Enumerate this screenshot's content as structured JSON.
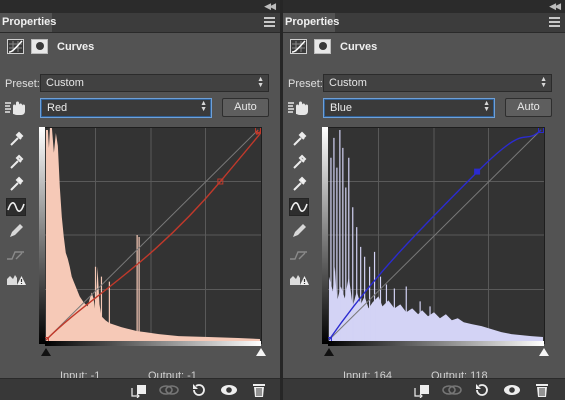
{
  "panels": [
    {
      "tab_label": "Properties",
      "adjustment_title": "Curves",
      "preset_label": "Preset:",
      "preset_value": "Custom",
      "channel_value": "Red",
      "auto_label": "Auto",
      "input_readout": "Input: -1",
      "output_readout": "Output: -1",
      "curve_color": "#c0392b",
      "histogram_color": "#f6c9b7",
      "gradient_color": "#ffffff"
    },
    {
      "tab_label": "Properties",
      "adjustment_title": "Curves",
      "preset_label": "Preset:",
      "preset_value": "Custom",
      "channel_value": "Blue",
      "auto_label": "Auto",
      "input_readout": "Input: 164",
      "output_readout": "Output: 118",
      "curve_color": "#2b2bd0",
      "histogram_color": "#d3d3f5",
      "gradient_color": "#ffffff"
    }
  ],
  "tools": [
    "curves-adjust-icon",
    "mask-icon",
    "on-image-adjust-icon",
    "black-point-eyedropper-icon",
    "gray-point-eyedropper-icon",
    "white-point-eyedropper-icon",
    "edit-points-curve-icon",
    "draw-pencil-icon",
    "smooth-curve-icon",
    "clipping-warning-icon"
  ],
  "footer_icons": [
    "clip-to-layer-icon",
    "view-previous-icon",
    "reset-icon",
    "visibility-eye-icon",
    "trash-icon"
  ]
}
